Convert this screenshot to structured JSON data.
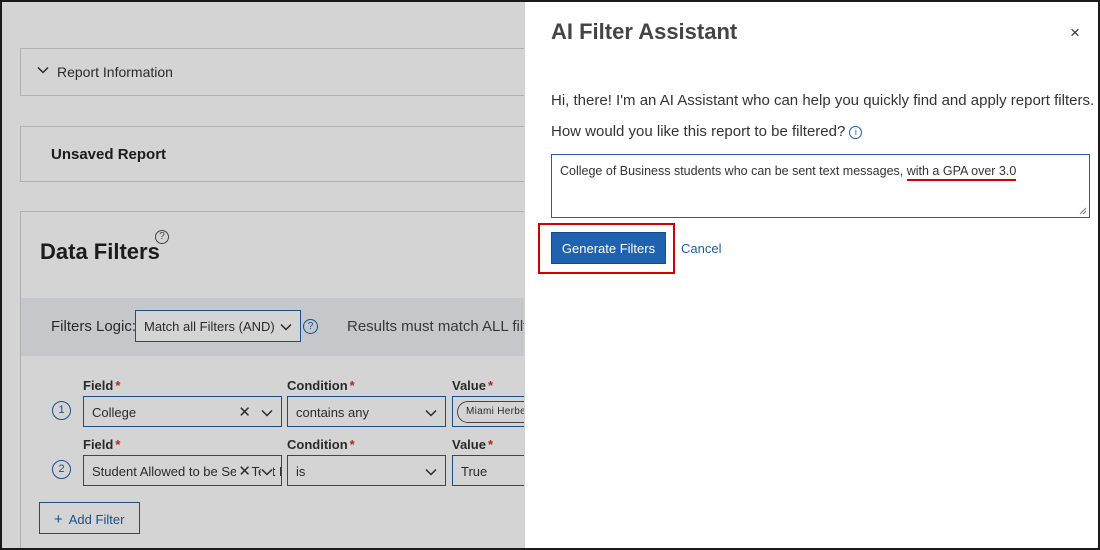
{
  "report": {
    "report_information_label": "Report Information",
    "unsaved_title": "Unsaved Report",
    "data_filters_title": "Data Filters",
    "help_glyph": "?",
    "filters_logic_label": "Filters Logic:",
    "filters_logic_value": "Match all Filters (AND)",
    "results_text": "Results must match ALL filters",
    "add_filter_label": "Add Filter",
    "rows": [
      {
        "num": "1",
        "field_label": "Field",
        "condition_label": "Condition",
        "value_label": "Value",
        "field_value": "College",
        "condition_value": "contains any",
        "value": "Miami Herbert Business School"
      },
      {
        "num": "2",
        "field_label": "Field",
        "condition_label": "Condition",
        "value_label": "Value",
        "field_value": "Student Allowed to be Sent Text Messages",
        "condition_value": "is",
        "value": "True"
      }
    ]
  },
  "assistant": {
    "title": "AI Filter Assistant",
    "close": "×",
    "intro": "Hi, there! I'm an AI Assistant who can help you quickly find and apply report filters.",
    "question": "How would you like this report to be filtered?",
    "prompt_part1": "College of Business students who can be sent text messages, ",
    "prompt_part2": "with a GPA over 3.0",
    "generate_label": "Generate Filters",
    "cancel_label": "Cancel"
  },
  "colors": {
    "accent": "#1e5fa8",
    "button_bg": "#1f62b0",
    "highlight": "#d40000",
    "required": "#c0392b"
  },
  "icons": [
    "chevron-down-icon",
    "help-icon",
    "info-icon",
    "close-icon",
    "clear-icon",
    "plus-icon",
    "resize-handle-icon"
  ]
}
